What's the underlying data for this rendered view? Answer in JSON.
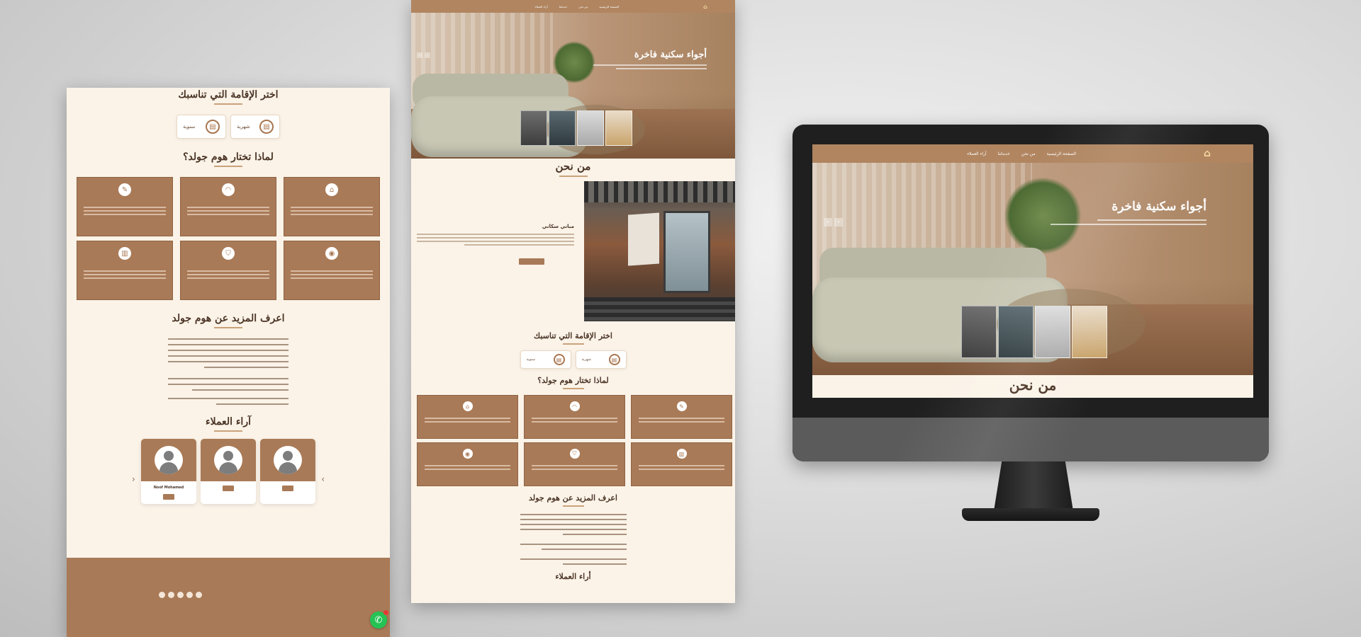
{
  "left_page": {
    "stay_title": "اختر الإقامة التي تناسبك",
    "stay_options": [
      "شهرية",
      "سنوية"
    ],
    "why_title": "لماذا تختار هوم جولد؟",
    "features": [
      "",
      "",
      "",
      "",
      "",
      ""
    ],
    "learn_title": "اعرف المزيد عن هوم جولد",
    "learn_paragraphs": [
      "",
      "",
      ""
    ],
    "reviews_title": "آراء العملاء",
    "reviews": [
      {
        "name": ""
      },
      {
        "name": ""
      },
      {
        "name": "Noof Mohamed"
      }
    ]
  },
  "mid_page": {
    "nav_links": [
      "الصفحة الرئيسية",
      "من نحن",
      "خدماتنا",
      "آراء العملاء"
    ],
    "hero_title": "أجواء سكنية فاخرة",
    "about_title": "من نحن",
    "building_name": "مباني سكاني",
    "stay_title": "اختر الإقامة التي تناسبك",
    "stay_options": [
      "شهرية",
      "سنوية"
    ],
    "why_title": "لماذا تختار هوم جولد؟",
    "learn_title": "اعرف المزيد عن هوم جولد",
    "reviews_title": "أراء العملاء"
  },
  "monitor": {
    "nav_links": [
      "الصفحة الرئيسية",
      "من نحن",
      "خدماتنا",
      "آراء العملاء"
    ],
    "hero_title": "أجواء سكنية فاخرة",
    "about_title": "من نحن"
  },
  "icons": {
    "whatsapp": "whatsapp-icon",
    "feature_icons": [
      "home-icon",
      "wifi-icon",
      "brush-icon",
      "location-icon",
      "shield-icon",
      "building-icon"
    ],
    "stay_icon": "calendar-icon"
  },
  "colors": {
    "brand_brown": "#a97a57",
    "cream": "#fbf3e8",
    "dark_text": "#4a3425",
    "whatsapp_green": "#25c354"
  }
}
